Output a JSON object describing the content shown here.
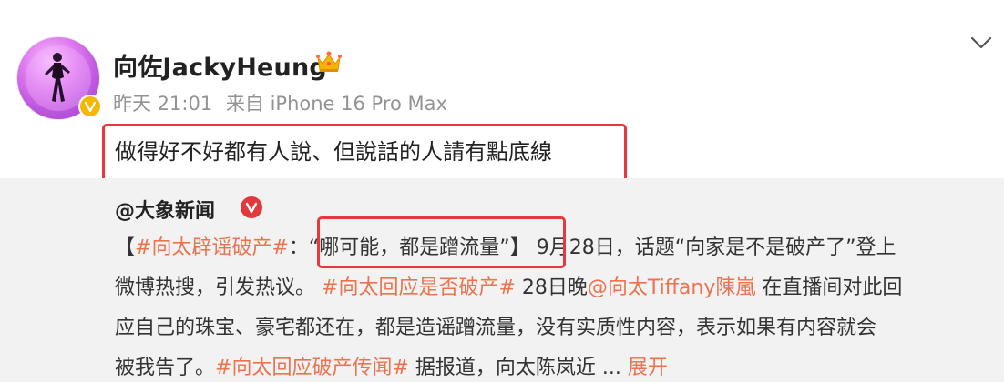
{
  "post": {
    "username": "向佐JackyHeung",
    "time": "昨天 21:01",
    "source": "来自 iPhone 16 Pro Max",
    "text": "做得好不好都有人說、但說話的人請有點底線"
  },
  "repost": {
    "author": "@大象新闻",
    "line1": {
      "bracket_open": "【",
      "tag1": "#向太辟谣破产#",
      "colon": "：",
      "quote": "“哪可能，都是蹭流量”",
      "bracket_close": "】",
      "text": "9月28日，话题“向家是不是破产了”登上"
    },
    "line2": {
      "text1": "微博热搜，引发热议。",
      "tag2": "#向太回应是否破产#",
      "text2": "28日晚",
      "mention": "@向太Tiffany陳嵐",
      "text3": "在直播间对此回"
    },
    "line3": {
      "text": "应自己的珠宝、豪宅都还在，都是造谣蹭流量，没有实质性内容，表示如果有内容就会"
    },
    "line4": {
      "text1": "被我告了。",
      "tag3": "#向太回应破产传闻#",
      "text2": "据报道，向太陈岚近",
      "ellipsis": "...",
      "expand": "展开"
    }
  },
  "colors": {
    "tag": "#eb7350",
    "highlight_box": "#e8383d",
    "repost_bg": "#f2f2f2",
    "meta_gray": "#939393"
  },
  "icons": {
    "crown": "crown-icon",
    "verified": "verified-badge-icon",
    "chevron": "chevron-down-icon",
    "media_badge": "weibo-v-icon"
  }
}
